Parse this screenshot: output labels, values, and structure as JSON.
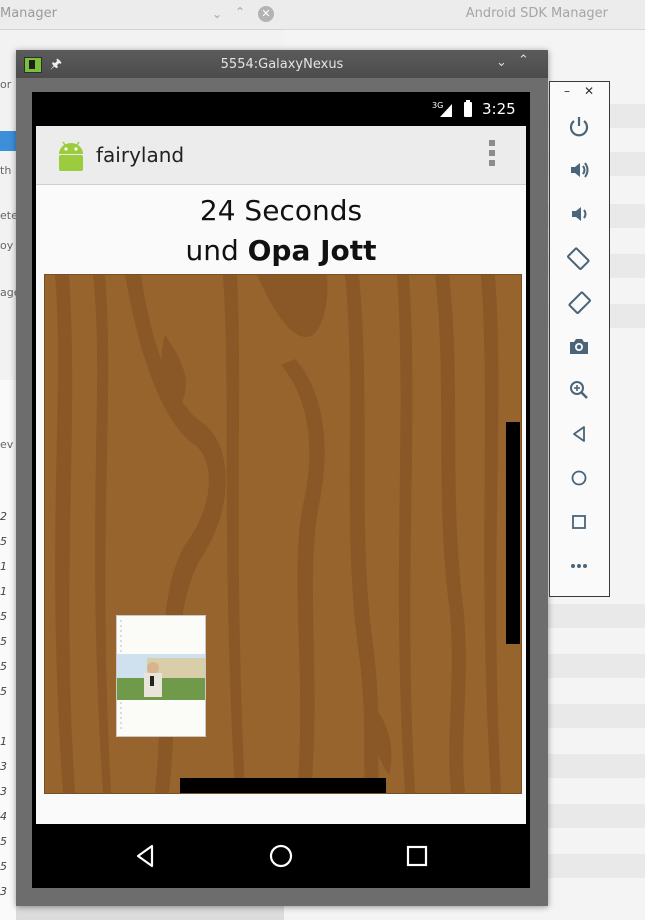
{
  "background": {
    "left_window_title": "Manager",
    "right_window_title": "Android SDK Manager",
    "left_fragments": [
      "or",
      "th",
      "ete",
      "oy",
      "age",
      "ev"
    ],
    "row_numbers": [
      "2",
      "5",
      "1",
      "1",
      "5",
      "5",
      "5",
      "5",
      "1",
      "3",
      "3",
      "4",
      "5",
      "5",
      "3"
    ]
  },
  "emulator": {
    "window_title": "5554:GalaxyNexus",
    "status": {
      "network": "3G",
      "time": "3:25"
    },
    "app": {
      "name": "fairyland"
    },
    "score": {
      "line1": "24 Seconds",
      "line2_prefix": "und",
      "line2_name": "Opa Jott"
    },
    "game": {
      "board_color": "#98642d",
      "grain_color": "#8a5726",
      "paddle_color": "#000000"
    },
    "nav": {
      "back": "back-icon",
      "home": "home-icon",
      "recents": "recents-icon"
    }
  },
  "side_controls": {
    "buttons": [
      "power-icon",
      "volume-up-icon",
      "volume-down-icon",
      "rotate-left-icon",
      "rotate-right-icon",
      "camera-icon",
      "zoom-icon",
      "back-icon",
      "home-icon",
      "overview-icon",
      "more-icon"
    ]
  }
}
